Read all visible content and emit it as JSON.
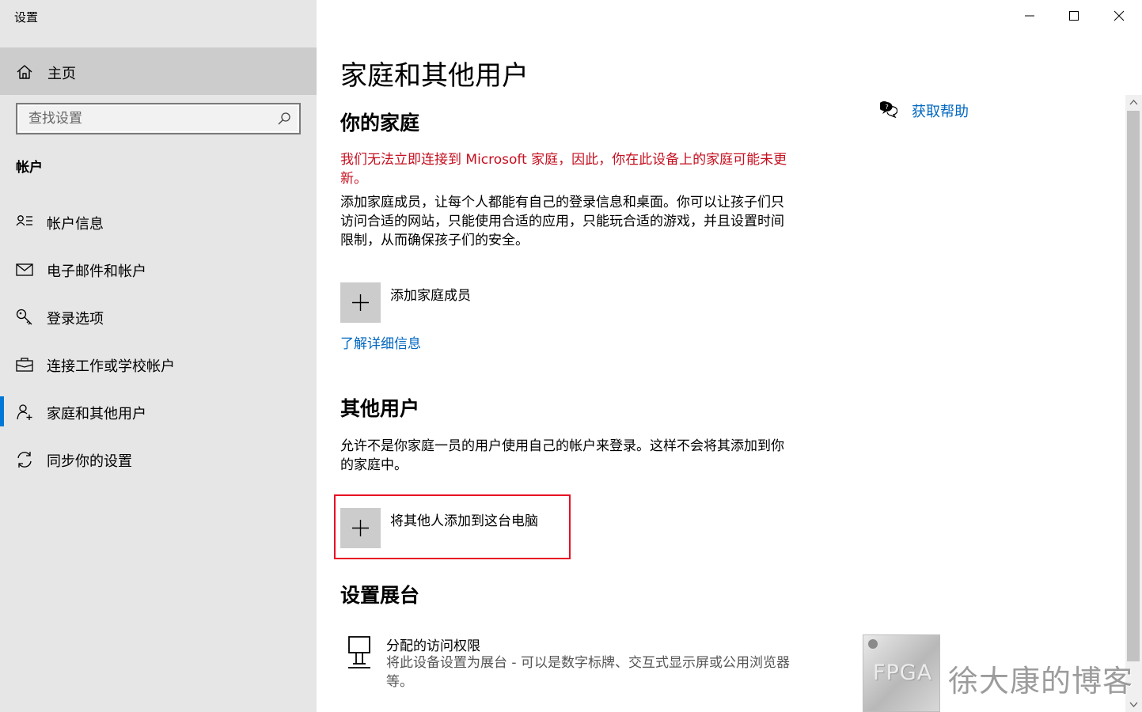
{
  "window": {
    "title": "设置",
    "controls": {
      "minimize": "minimize",
      "maximize": "maximize",
      "close": "close"
    }
  },
  "sidebar": {
    "home_label": "主页",
    "search_placeholder": "查找设置",
    "section_heading": "帐户",
    "items": [
      {
        "label": "帐户信息",
        "icon": "person-list-icon"
      },
      {
        "label": "电子邮件和帐户",
        "icon": "mail-icon"
      },
      {
        "label": "登录选项",
        "icon": "key-icon"
      },
      {
        "label": "连接工作或学校帐户",
        "icon": "briefcase-icon"
      },
      {
        "label": "家庭和其他用户",
        "icon": "person-add-icon",
        "selected": true
      },
      {
        "label": "同步你的设置",
        "icon": "sync-icon"
      }
    ]
  },
  "main": {
    "page_title": "家庭和其他用户",
    "family": {
      "heading": "你的家庭",
      "warning": "我们无法立即连接到 Microsoft 家庭，因此，你在此设备上的家庭可能未更新。",
      "description": "添加家庭成员，让每个人都能有自己的登录信息和桌面。你可以让孩子们只访问合适的网站，只能使用合适的应用，只能玩合适的游戏，并且设置时间限制，从而确保孩子们的安全。",
      "add_label": "添加家庭成员",
      "learn_more": "了解详细信息"
    },
    "other_users": {
      "heading": "其他用户",
      "description": "允许不是你家庭一员的用户使用自己的帐户来登录。这样不会将其添加到你的家庭中。",
      "add_label": "将其他人添加到这台电脑"
    },
    "kiosk": {
      "heading": "设置展台",
      "title": "分配的访问权限",
      "description": "将此设备设置为展台 - 可以是数字标牌、交互式显示屏或公用浏览器等。"
    },
    "help": {
      "label": "获取帮助"
    }
  },
  "watermark": {
    "badge": "FPGA",
    "text": "徐大康的博客"
  },
  "colors": {
    "accent": "#0078d7",
    "link": "#0067c0",
    "warning": "#c50f1f",
    "highlight": "#e81123",
    "sidebar_bg": "#e6e6e6"
  }
}
